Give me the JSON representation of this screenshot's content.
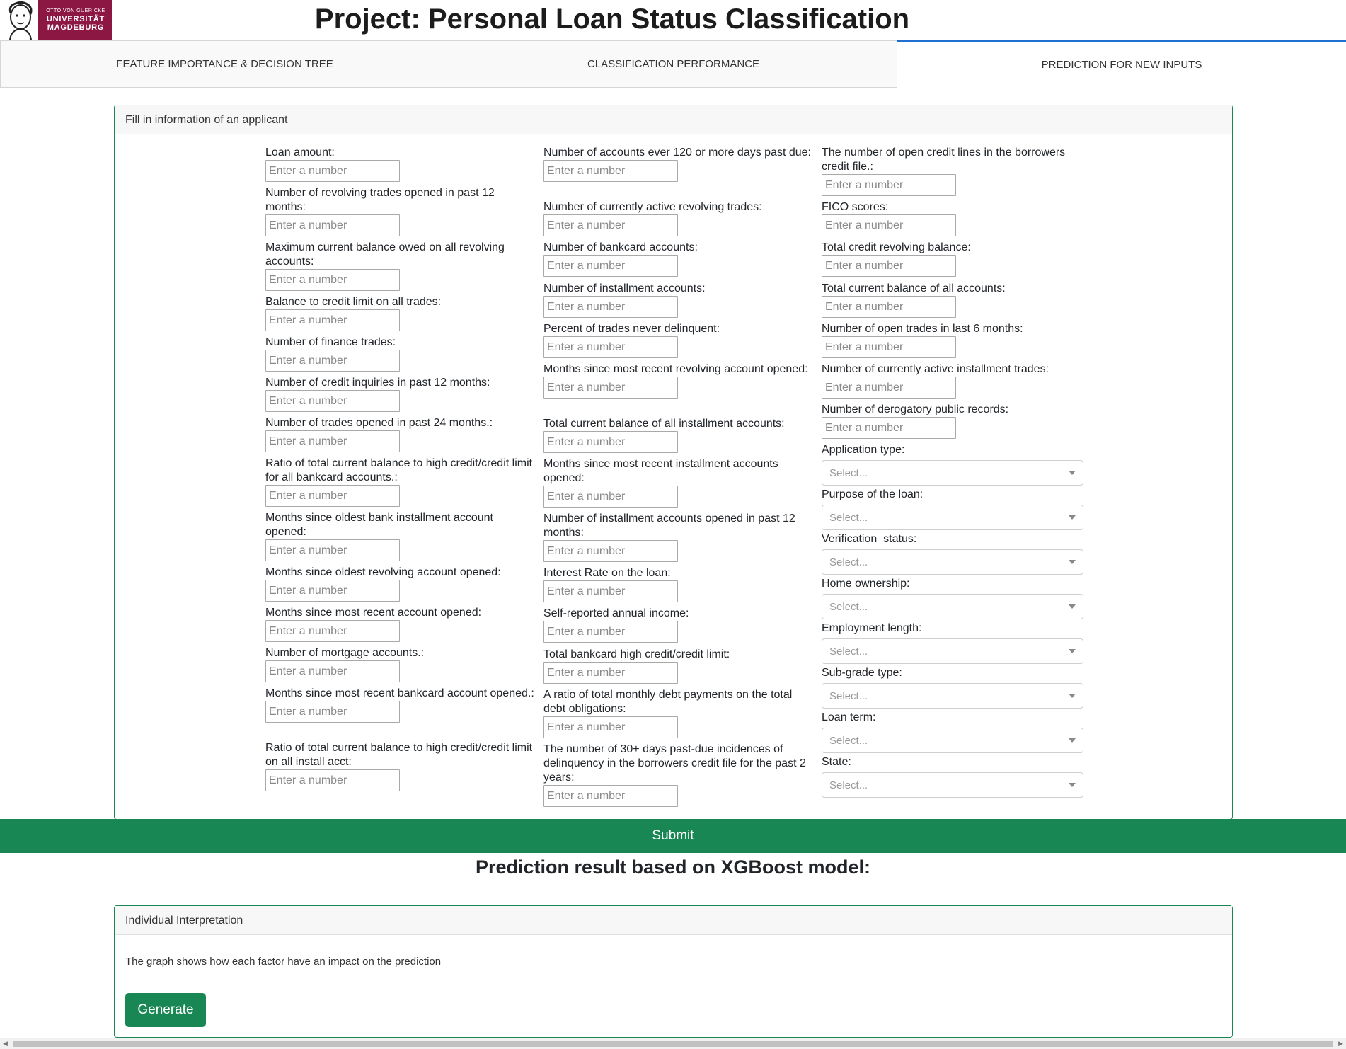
{
  "header": {
    "logo": {
      "line1": "OTTO VON GUERICKE",
      "line2": "UNIVERSITÄT",
      "line3": "MAGDEBURG"
    },
    "title": "Project: Personal Loan Status Classification"
  },
  "tabs": [
    {
      "label": "FEATURE IMPORTANCE & DECISION TREE",
      "active": false
    },
    {
      "label": "CLASSIFICATION PERFORMANCE",
      "active": false
    },
    {
      "label": "PREDICTION FOR NEW INPUTS",
      "active": true
    }
  ],
  "form": {
    "header": "Fill in information of an applicant",
    "placeholder": "Enter a number",
    "select_placeholder": "Select...",
    "col1": [
      "Loan amount:",
      "Number of revolving trades opened in past 12 months:",
      "Maximum current balance owed on all revolving accounts:",
      "Balance to credit limit on all trades:",
      "Number of finance trades:",
      "Number of credit inquiries in past 12 months:",
      "Number of trades opened in past 24 months.:",
      "Ratio of total current balance to high credit/credit limit for all bankcard accounts.:",
      "Months since oldest bank installment account opened:",
      "Months since oldest revolving account opened:",
      "Months since most recent account opened:",
      "Number of mortgage accounts.:",
      "Months since most recent bankcard account opened.:",
      "Ratio of total current balance to high credit/credit limit on all install acct:"
    ],
    "col2": [
      "Number of accounts ever 120 or more days past due:",
      "Number of currently active revolving trades:",
      "Number of bankcard accounts:",
      "Number of installment accounts:",
      "Percent of trades never delinquent:",
      "Months since most recent revolving account opened:",
      "Total current balance of all installment accounts:",
      "Months since most recent installment accounts opened:",
      "Number of installment accounts opened in past 12 months:",
      "Interest Rate on the loan:",
      "Self-reported annual income:",
      "Total bankcard high credit/credit limit:",
      "A ratio of total monthly debt payments on the total debt obligations:",
      "The number of 30+ days past-due incidences of delinquency in the borrowers credit file for the past 2 years:"
    ],
    "col3_inputs": [
      "The number of open credit lines in the borrowers credit file.:",
      "FICO scores:",
      "Total credit revolving balance:",
      "Total current balance of all accounts:",
      "Number of open trades in last 6 months:",
      "Number of currently active installment trades:",
      "Number of derogatory public records:"
    ],
    "col3_selects": [
      "Application type:",
      "Purpose of the loan:",
      "Verification_status:",
      "Home ownership:",
      "Employment length:",
      "Sub-grade type:",
      "Loan term:",
      "State:"
    ],
    "submit_label": "Submit"
  },
  "result": {
    "title": "Prediction result based on XGBoost model:"
  },
  "interpretation": {
    "header": "Individual Interpretation",
    "text": "The graph shows how each factor have an impact on the prediction",
    "button_label": "Generate"
  }
}
